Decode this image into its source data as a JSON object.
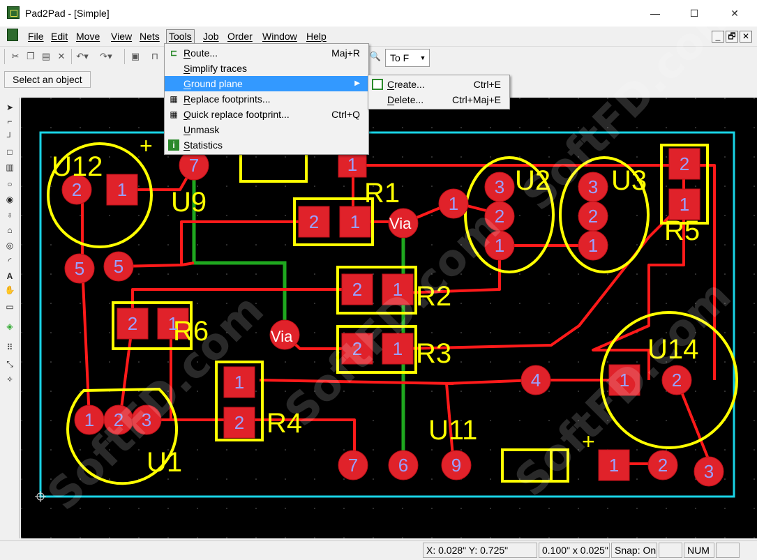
{
  "window": {
    "title": "Pad2Pad - [Simple]",
    "minimize_glyph": "—",
    "maximize_glyph": "☐",
    "close_glyph": "✕"
  },
  "menubar": {
    "items": [
      "File",
      "Edit",
      "Move",
      "View",
      "Nets",
      "Tools",
      "Job",
      "Order",
      "Window",
      "Help"
    ],
    "active": "Tools",
    "mdi_buttons": [
      "_",
      "🗗",
      "✕"
    ]
  },
  "toolbar": {
    "to_field": "To F",
    "icons": [
      "cut-icon",
      "copy-icon",
      "paste-icon",
      "delete-icon",
      "undo-icon",
      "redo-icon",
      "properties-icon",
      "measure-icon",
      "zoom-icon"
    ]
  },
  "selectbar": {
    "label": "Select an object"
  },
  "tools_menu": {
    "items": [
      {
        "label": "Route...",
        "shortcut": "Maj+R",
        "icon": "route-icon"
      },
      {
        "label": "Simplify traces",
        "shortcut": "",
        "icon": ""
      },
      {
        "label": "Ground plane",
        "shortcut": "▶",
        "icon": "",
        "highlighted": true
      },
      {
        "label": "Replace footprints...",
        "shortcut": "",
        "icon": "chip-icon"
      },
      {
        "label": "Quick replace footprint...",
        "shortcut": "Ctrl+Q",
        "icon": "chip-icon"
      },
      {
        "label": "Unmask",
        "shortcut": "",
        "icon": ""
      },
      {
        "label": "Statistics",
        "shortcut": "",
        "icon": "info-icon"
      }
    ]
  },
  "ground_menu": {
    "items": [
      {
        "label": "Create...",
        "shortcut": "Ctrl+E",
        "icon": "ground-plane-icon"
      },
      {
        "label": "Delete...",
        "shortcut": "Ctrl+Maj+E",
        "icon": ""
      }
    ]
  },
  "pcb": {
    "board_outline_color": "#19d3e6",
    "trace_color": "#ff1a1a",
    "ground_trace_color": "#1fa81f",
    "silkscreen_color": "#ffff00",
    "pad_color": "#e0222a",
    "pad_label_color": "#9aa0ff",
    "components": [
      "U12",
      "U9",
      "R1",
      "U2",
      "U3",
      "R5",
      "R2",
      "R6",
      "R3",
      "U14",
      "R4",
      "U11",
      "U1"
    ],
    "via_label": "Via",
    "pins": {
      "u12_1": "1",
      "u12_2": "2",
      "u9_5a": "5",
      "u9_5b": "5",
      "u9_7": "7",
      "r1_2": "2",
      "r1_1": "1",
      "r1_top": "1",
      "u2_1": "1",
      "u2_2": "2",
      "u2_3": "3",
      "u2_l1": "1",
      "u3_1": "1",
      "u3_2": "2",
      "u3_3": "3",
      "r5_2": "2",
      "r5_1": "1",
      "r2_2": "2",
      "r2_1": "1",
      "r6_2": "2",
      "r6_1": "1",
      "r3_2": "2",
      "r3_1": "1",
      "u14_1": "1",
      "u14_2": "2",
      "u14_3": "3",
      "u14_4": "4",
      "u14_p1": "1",
      "u14_p2": "2",
      "r4_1": "1",
      "r4_2": "2",
      "u11_7": "7",
      "u11_6": "6",
      "u11_9": "9",
      "u1_1": "1",
      "u1_2": "2",
      "u1_3": "3"
    },
    "plus_sign": "+"
  },
  "watermark": "SoftFD.com",
  "statusbar": {
    "coords": "X: 0.028\" Y: 0.725\"",
    "grid": "0.100\" x 0.025\"",
    "snap": "Snap: On",
    "blank": "",
    "num": "NUM"
  }
}
